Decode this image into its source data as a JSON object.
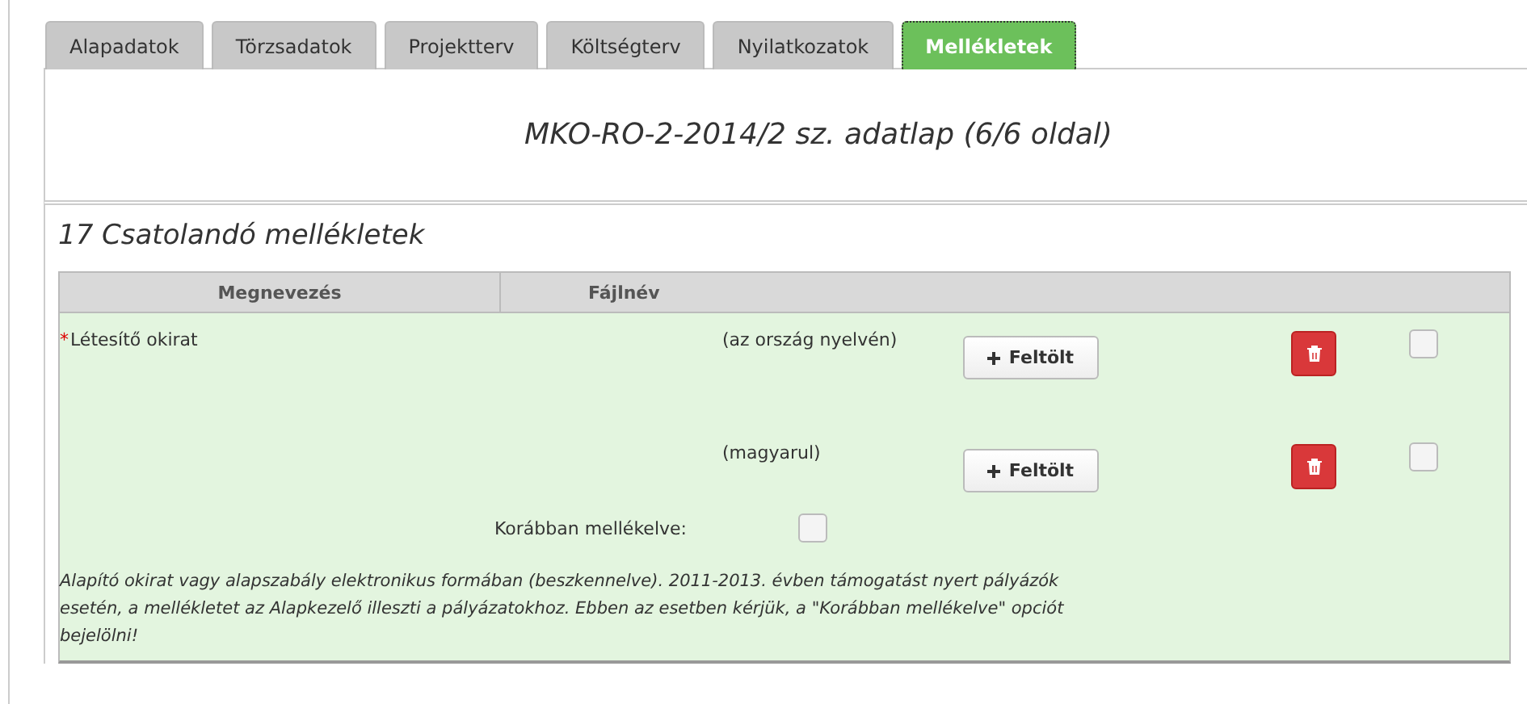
{
  "tabs": [
    {
      "label": "Alapadatok",
      "selected": false
    },
    {
      "label": "Törzsadatok",
      "selected": false
    },
    {
      "label": "Projektterv",
      "selected": false
    },
    {
      "label": "Költségterv",
      "selected": false
    },
    {
      "label": "Nyilatkozatok",
      "selected": false
    },
    {
      "label": "Mellékletek",
      "selected": true
    }
  ],
  "page_title": "MKO-RO-2-2014/2 sz. adatlap (6/6 oldal)",
  "section_title": "17 Csatolandó mellékletek",
  "table": {
    "columns": [
      "Megnevezés",
      "Fájlnév"
    ],
    "item": {
      "required_mark": "*",
      "name": "Létesítő okirat",
      "files": [
        {
          "label": "(az ország nyelvén)",
          "upload": "Feltölt",
          "checked": false
        },
        {
          "label": "(magyarul)",
          "upload": "Feltölt",
          "checked": false
        }
      ],
      "previously_attached": {
        "label": "Korábban mellékelve:",
        "checked": false
      },
      "note": "Alapító okirat vagy alapszabály elektronikus formában (beszkennelve). 2011-2013. évben támogatást nyert pályázók esetén, a mellékletet az Alapkezelő illeszti a pályázatokhoz. Ebben az esetben kérjük, a \"Korábban mellékelve\" opciót bejelölni!"
    }
  }
}
